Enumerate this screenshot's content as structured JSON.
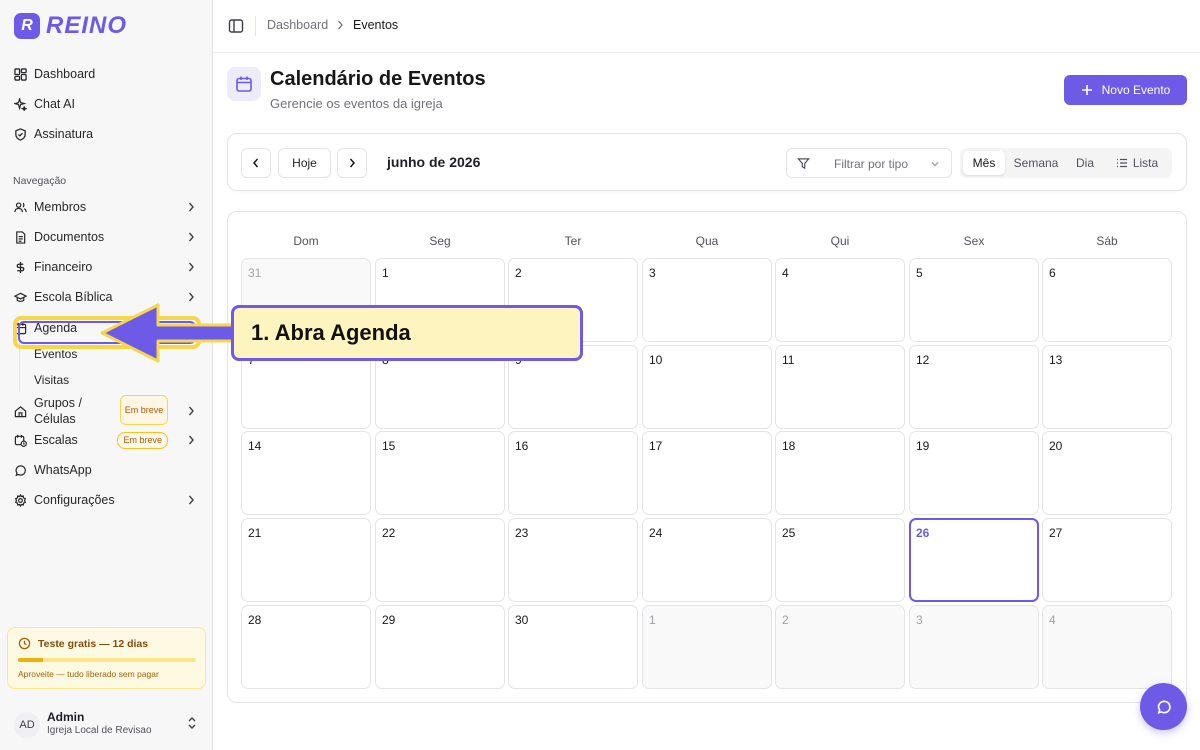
{
  "brand": {
    "name": "REINO",
    "mark": "R"
  },
  "sidebar": {
    "top_items": [
      {
        "label": "Dashboard",
        "icon": "dashboard-icon"
      },
      {
        "label": "Chat AI",
        "icon": "sparkles-icon"
      },
      {
        "label": "Assinatura",
        "icon": "shield-check-icon"
      }
    ],
    "section_label": "Navegação",
    "items": [
      {
        "label": "Membros",
        "icon": "users-icon"
      },
      {
        "label": "Documentos",
        "icon": "file-icon"
      },
      {
        "label": "Financeiro",
        "icon": "dollar-icon"
      },
      {
        "label": "Escola Bíblica",
        "icon": "graduation-cap-icon"
      },
      {
        "label": "Agenda",
        "icon": "calendar-icon"
      },
      {
        "label": "Grupos / Células",
        "label_line1": "Grupos /",
        "label_line2": "Células",
        "icon": "home-icon",
        "badge": "Em breve"
      },
      {
        "label": "Escalas",
        "icon": "calendar-clock-icon",
        "badge": "Em breve"
      },
      {
        "label": "WhatsApp",
        "icon": "message-circle-icon"
      },
      {
        "label": "Configurações",
        "icon": "gear-icon"
      }
    ],
    "agenda_sub": [
      "Eventos",
      "Visitas"
    ],
    "trial": {
      "title": "Teste gratis — 12 dias",
      "subtitle": "Aproveite — tudo liberado sem pagar",
      "progress": 0.14
    },
    "user": {
      "initials": "AD",
      "name": "Admin",
      "church": "Igreja Local de Revisao"
    }
  },
  "breadcrumb": {
    "root": "Dashboard",
    "current": "Eventos"
  },
  "page": {
    "title": "Calendário de Eventos",
    "subtitle": "Gerencie os eventos da igreja",
    "new_button": "Novo Evento"
  },
  "toolbar": {
    "today": "Hoje",
    "month_label": "junho de 2026",
    "filter_placeholder": "Filtrar por tipo",
    "views": [
      "Mês",
      "Semana",
      "Dia",
      "Lista"
    ],
    "active_view": "Mês"
  },
  "calendar": {
    "weekdays": [
      "Dom",
      "Seg",
      "Ter",
      "Qua",
      "Qui",
      "Sex",
      "Sáb"
    ],
    "weeks": [
      [
        {
          "d": "31",
          "other": true
        },
        {
          "d": "1"
        },
        {
          "d": "2"
        },
        {
          "d": "3"
        },
        {
          "d": "4"
        },
        {
          "d": "5"
        },
        {
          "d": "6"
        }
      ],
      [
        {
          "d": "7"
        },
        {
          "d": "8"
        },
        {
          "d": "9"
        },
        {
          "d": "10"
        },
        {
          "d": "11"
        },
        {
          "d": "12"
        },
        {
          "d": "13"
        }
      ],
      [
        {
          "d": "14"
        },
        {
          "d": "15"
        },
        {
          "d": "16"
        },
        {
          "d": "17"
        },
        {
          "d": "18"
        },
        {
          "d": "19"
        },
        {
          "d": "20"
        }
      ],
      [
        {
          "d": "21"
        },
        {
          "d": "22"
        },
        {
          "d": "23"
        },
        {
          "d": "24"
        },
        {
          "d": "25"
        },
        {
          "d": "26",
          "today": true
        },
        {
          "d": "27"
        }
      ],
      [
        {
          "d": "28"
        },
        {
          "d": "29"
        },
        {
          "d": "30"
        },
        {
          "d": "1",
          "other": true
        },
        {
          "d": "2",
          "other": true
        },
        {
          "d": "3",
          "other": true
        },
        {
          "d": "4",
          "other": true
        }
      ]
    ]
  },
  "callout": {
    "text": "1. Abra Agenda"
  },
  "colors": {
    "accent": "#6d5ae6",
    "highlight": "#f6d64b",
    "callout_bg": "#fdf4bf"
  }
}
